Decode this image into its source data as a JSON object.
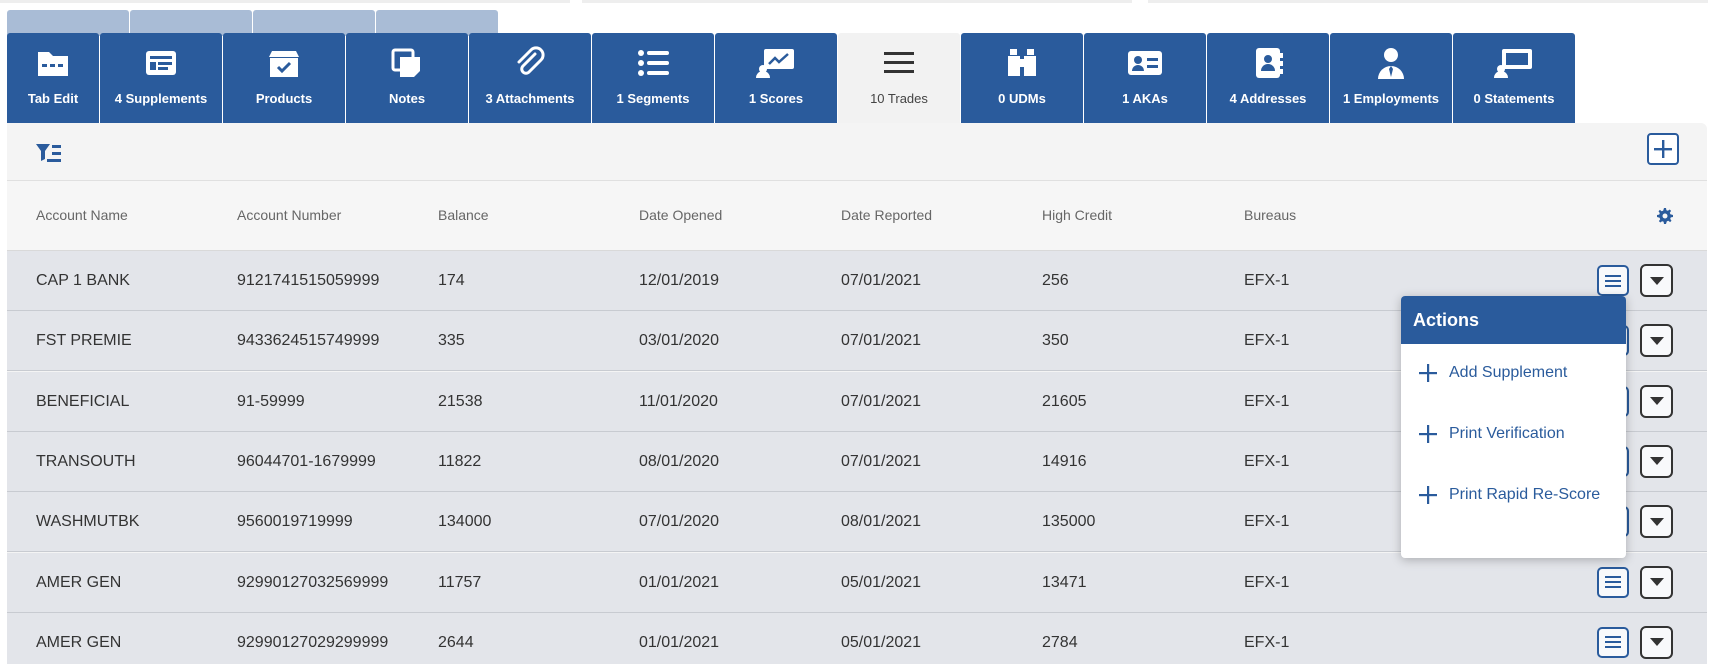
{
  "tabs": [
    {
      "label": "Tab Edit",
      "icon": "folder-icon"
    },
    {
      "label": "4 Supplements",
      "icon": "list-card-icon"
    },
    {
      "label": "Products",
      "icon": "box-check-icon"
    },
    {
      "label": "Notes",
      "icon": "notes-icon"
    },
    {
      "label": "3 Attachments",
      "icon": "paperclip-icon"
    },
    {
      "label": "1 Segments",
      "icon": "list-icon"
    },
    {
      "label": "1 Scores",
      "icon": "chart-screen-icon"
    },
    {
      "label": "10 Trades",
      "icon": "menu-lines-icon"
    },
    {
      "label": "0 UDMs",
      "icon": "binoculars-icon"
    },
    {
      "label": "1 AKAs",
      "icon": "id-card-icon"
    },
    {
      "label": "4 Addresses",
      "icon": "address-book-icon"
    },
    {
      "label": "1 Employments",
      "icon": "user-tie-icon"
    },
    {
      "label": "0 Statements",
      "icon": "screen-icon"
    }
  ],
  "active_tab": "10 Trades",
  "columns": [
    "Account Name",
    "Account Number",
    "Balance",
    "Date Opened",
    "Date Reported",
    "High Credit",
    "Bureaus"
  ],
  "rows": [
    [
      "CAP 1 BANK",
      "9121741515059999",
      "174",
      "12/01/2019",
      "07/01/2021",
      "256",
      "EFX-1"
    ],
    [
      "FST PREMIE",
      "9433624515749999",
      "335",
      "03/01/2020",
      "07/01/2021",
      "350",
      "EFX-1"
    ],
    [
      "BENEFICIAL",
      "91-59999",
      "21538",
      "11/01/2020",
      "07/01/2021",
      "21605",
      "EFX-1"
    ],
    [
      "TRANSOUTH",
      "96044701-1679999",
      "11822",
      "08/01/2020",
      "07/01/2021",
      "14916",
      "EFX-1"
    ],
    [
      "WASHMUTBK",
      "9560019719999",
      "134000",
      "07/01/2020",
      "08/01/2021",
      "135000",
      "EFX-1"
    ],
    [
      "AMER GEN",
      "92990127032569999",
      "11757",
      "01/01/2021",
      "05/01/2021",
      "13471",
      "EFX-1"
    ],
    [
      "AMER GEN",
      "92990127029299999",
      "2644",
      "01/01/2021",
      "05/01/2021",
      "2784",
      "EFX-1"
    ]
  ],
  "actions_menu": {
    "title": "Actions",
    "items": [
      "Add Supplement",
      "Print Verification",
      "Print Rapid Re-Score"
    ]
  },
  "colors": {
    "primary": "#2a5b9c",
    "row_bg": "#e3e5ea",
    "header_bg": "#f6f6f6"
  }
}
